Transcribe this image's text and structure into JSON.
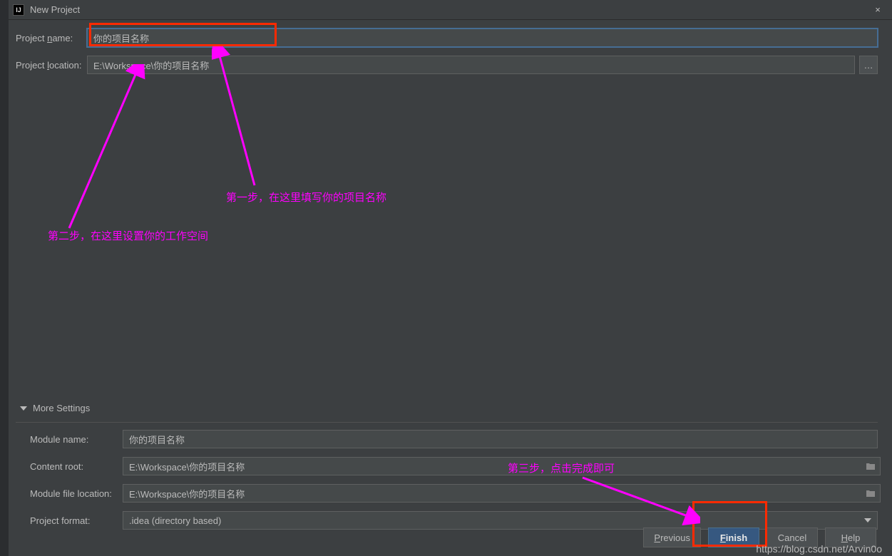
{
  "titlebar": {
    "icon_text": "IJ",
    "title": "New Project",
    "close_glyph": "×"
  },
  "form": {
    "project_name_label_pre": "Project ",
    "project_name_label_u": "n",
    "project_name_label_post": "ame:",
    "project_name_value": "你的项目名称",
    "project_location_label_pre": "Project ",
    "project_location_label_u": "l",
    "project_location_label_post": "ocation:",
    "project_location_value": "E:\\Workspace\\你的项目名称",
    "browse_glyph": "…"
  },
  "annotations": {
    "step1": "第一步，在这里填写你的项目名称",
    "step2": "第二步，在这里设置你的工作空间",
    "step3": "第三步，点击完成即可"
  },
  "more_settings": {
    "header": "More Settings",
    "module_name_label": "Module name:",
    "module_name_value": "你的项目名称",
    "content_root_label": "Content root:",
    "content_root_value": "E:\\Workspace\\你的项目名称",
    "module_file_label": "Module file location:",
    "module_file_value": "E:\\Workspace\\你的项目名称",
    "project_format_label": "Project format:",
    "project_format_value": ".idea (directory based)"
  },
  "buttons": {
    "previous_u": "P",
    "previous_rest": "revious",
    "finish_u": "F",
    "finish_rest": "inish",
    "cancel": "Cancel",
    "help_u": "H",
    "help_rest": "elp"
  },
  "watermark": "https://blog.csdn.net/Arvin0o"
}
